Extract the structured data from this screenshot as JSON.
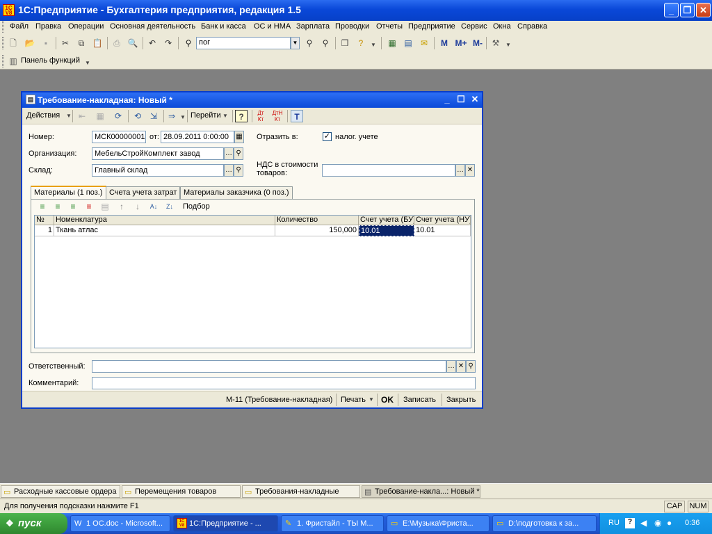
{
  "app": {
    "logo_text": "1C\nV8",
    "title": "1С:Предприятие - Бухгалтерия предприятия, редакция 1.5"
  },
  "menu": [
    "Файл",
    "Правка",
    "Операции",
    "Основная деятельность",
    "Банк и касса",
    "ОС и НМА",
    "Зарплата",
    "Проводки",
    "Отчеты",
    "Предприятие",
    "Сервис",
    "Окна",
    "Справка"
  ],
  "search": {
    "value": "пог"
  },
  "toolbar_letters": {
    "m": "М",
    "m_plus": "М+",
    "m_minus": "М-"
  },
  "functions_panel": "Панель функций",
  "doc": {
    "title": "Требование-накладная: Новый *",
    "toolbar": {
      "actions": "Действия",
      "goto": "Перейти",
      "help": "?"
    },
    "fields": {
      "number_label": "Номер:",
      "number_value": "МСК00000001",
      "from_label": "от:",
      "date_value": "28.09.2011  0:00:00",
      "org_label": "Организация:",
      "org_value": "МебельСтройКомплект завод",
      "warehouse_label": "Склад:",
      "warehouse_value": "Главный склад",
      "reflect_label": "Отразить в:",
      "tax_label": "налог. учете",
      "vat_label_1": "НДС в стоимости",
      "vat_label_2": "товаров:",
      "vat_value": "",
      "responsible_label": "Ответственный:",
      "responsible_value": "",
      "comment_label": "Комментарий:",
      "comment_value": ""
    },
    "tabs": [
      "Материалы (1 поз.)",
      "Счета учета затрат",
      "Материалы заказчика (0 поз.)"
    ],
    "table_toolbar": {
      "select": "Подбор"
    },
    "table": {
      "headers": [
        "№",
        "Номенклатура",
        "Количество",
        "Счет учета (БУ)",
        "Счет учета (НУ)"
      ],
      "rows": [
        {
          "n": "1",
          "item": "Ткань атлас",
          "qty": "150,000",
          "acc_bu": "10.01",
          "acc_nu": "10.01"
        }
      ]
    },
    "footer": {
      "print_form": "М-11 (Требование-накладная)",
      "print": "Печать",
      "ok": "OK",
      "save": "Записать",
      "close": "Закрыть"
    }
  },
  "windows_bar": [
    "Расходные кассовые ордера",
    "Перемещения товаров",
    "Требования-накладные",
    "Требование-накла...: Новый *"
  ],
  "status": {
    "hint": "Для получения подсказки нажмите F1",
    "cap": "CAP",
    "num": "NUM"
  },
  "taskbar": {
    "start": "пуск",
    "tasks": [
      "1 ОС.doc - Microsoft...",
      "1С:Предприятие - ...",
      "1. Фристайл - ТЫ М...",
      "E:\\Музыка\\Фриста...",
      "D:\\подготовка к за..."
    ],
    "lang": "RU",
    "time": "0:36"
  }
}
